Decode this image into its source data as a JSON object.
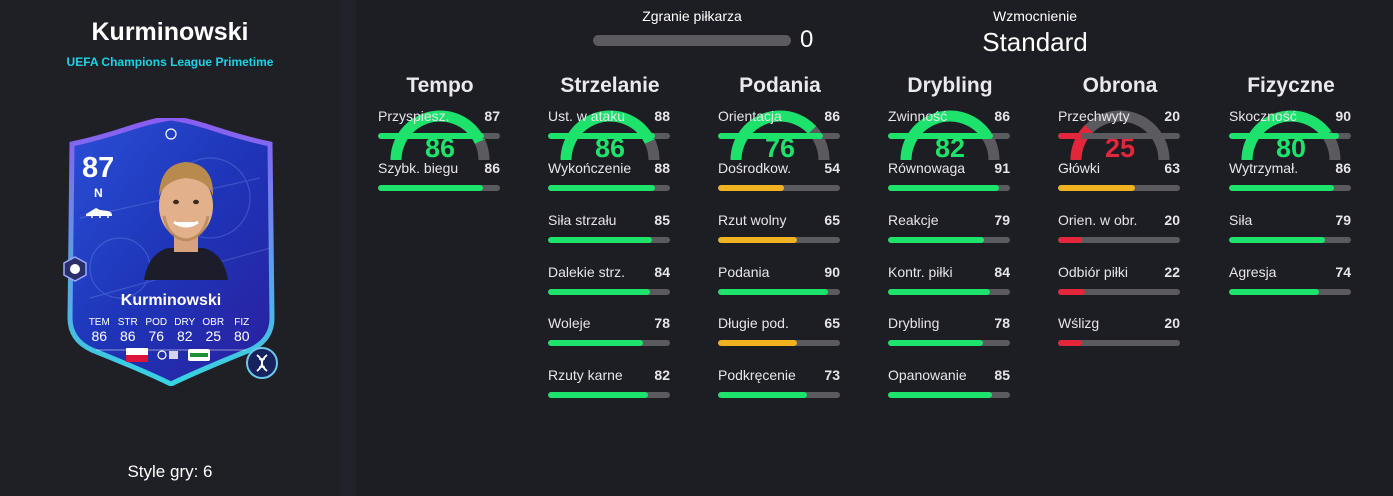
{
  "player": {
    "name": "Kurminowski",
    "promo": "UEFA Champions League Primetime",
    "style_label": "Style gry: 6"
  },
  "card": {
    "rating": "87",
    "position": "N",
    "name": "Kurminowski",
    "stats": [
      {
        "label": "TEM",
        "value": "86"
      },
      {
        "label": "STR",
        "value": "86"
      },
      {
        "label": "POD",
        "value": "76"
      },
      {
        "label": "DRY",
        "value": "82"
      },
      {
        "label": "OBR",
        "value": "25"
      },
      {
        "label": "FIZ",
        "value": "80"
      }
    ]
  },
  "chemistry": {
    "title": "Zgranie piłkarza",
    "value": "0"
  },
  "boost": {
    "title": "Wzmocnienie",
    "value": "Standard"
  },
  "colors": {
    "green": "#1de26b",
    "yellow": "#f0b31f",
    "red": "#e3263a",
    "track": "#5b5b5f"
  },
  "columns": [
    {
      "title": "Tempo",
      "value": "86",
      "level": 86,
      "color": "green",
      "stats": [
        {
          "name": "Przyspiesz.",
          "value": "87",
          "level": 87,
          "color": "green"
        },
        {
          "name": "Szybk. biegu",
          "value": "86",
          "level": 86,
          "color": "green"
        }
      ]
    },
    {
      "title": "Strzelanie",
      "value": "86",
      "level": 86,
      "color": "green",
      "stats": [
        {
          "name": "Ust. w ataku",
          "value": "88",
          "level": 88,
          "color": "green"
        },
        {
          "name": "Wykończenie",
          "value": "88",
          "level": 88,
          "color": "green"
        },
        {
          "name": "Siła strzału",
          "value": "85",
          "level": 85,
          "color": "green"
        },
        {
          "name": "Dalekie strz.",
          "value": "84",
          "level": 84,
          "color": "green"
        },
        {
          "name": "Woleje",
          "value": "78",
          "level": 78,
          "color": "green"
        },
        {
          "name": "Rzuty karne",
          "value": "82",
          "level": 82,
          "color": "green"
        }
      ]
    },
    {
      "title": "Podania",
      "value": "76",
      "level": 76,
      "color": "green",
      "stats": [
        {
          "name": "Orientacja",
          "value": "86",
          "level": 86,
          "color": "green"
        },
        {
          "name": "Dośrodkow.",
          "value": "54",
          "level": 54,
          "color": "yellow"
        },
        {
          "name": "Rzut wolny",
          "value": "65",
          "level": 65,
          "color": "yellow"
        },
        {
          "name": "Podania",
          "value": "90",
          "level": 90,
          "color": "green"
        },
        {
          "name": "Długie pod.",
          "value": "65",
          "level": 65,
          "color": "yellow"
        },
        {
          "name": "Podkręcenie",
          "value": "73",
          "level": 73,
          "color": "green"
        }
      ]
    },
    {
      "title": "Drybling",
      "value": "82",
      "level": 82,
      "color": "green",
      "stats": [
        {
          "name": "Zwinność",
          "value": "86",
          "level": 86,
          "color": "green"
        },
        {
          "name": "Równowaga",
          "value": "91",
          "level": 91,
          "color": "green"
        },
        {
          "name": "Reakcje",
          "value": "79",
          "level": 79,
          "color": "green"
        },
        {
          "name": "Kontr. piłki",
          "value": "84",
          "level": 84,
          "color": "green"
        },
        {
          "name": "Drybling",
          "value": "78",
          "level": 78,
          "color": "green"
        },
        {
          "name": "Opanowanie",
          "value": "85",
          "level": 85,
          "color": "green"
        }
      ]
    },
    {
      "title": "Obrona",
      "value": "25",
      "level": 25,
      "color": "red",
      "stats": [
        {
          "name": "Przechwyty",
          "value": "20",
          "level": 20,
          "color": "red"
        },
        {
          "name": "Główki",
          "value": "63",
          "level": 63,
          "color": "yellow"
        },
        {
          "name": "Orien. w obr.",
          "value": "20",
          "level": 20,
          "color": "red"
        },
        {
          "name": "Odbiór piłki",
          "value": "22",
          "level": 22,
          "color": "red"
        },
        {
          "name": "Wślizg",
          "value": "20",
          "level": 20,
          "color": "red"
        }
      ]
    },
    {
      "title": "Fizyczne",
      "value": "80",
      "level": 80,
      "color": "green",
      "stats": [
        {
          "name": "Skoczność",
          "value": "90",
          "level": 90,
          "color": "green"
        },
        {
          "name": "Wytrzymał.",
          "value": "86",
          "level": 86,
          "color": "green"
        },
        {
          "name": "Siła",
          "value": "79",
          "level": 79,
          "color": "green"
        },
        {
          "name": "Agresja",
          "value": "74",
          "level": 74,
          "color": "green"
        }
      ]
    }
  ]
}
